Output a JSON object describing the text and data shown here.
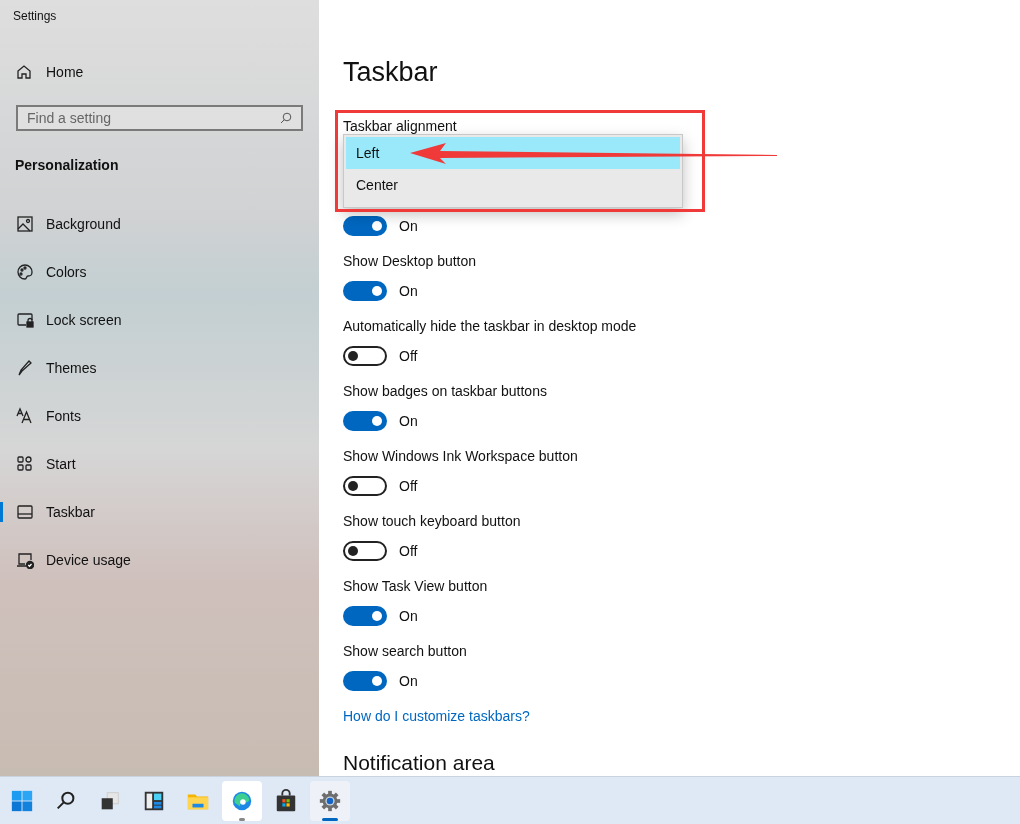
{
  "window": {
    "title": "Settings"
  },
  "sidebar": {
    "home": "Home",
    "search": {
      "placeholder": "Find a setting"
    },
    "section": "Personalization",
    "items": [
      {
        "label": "Background",
        "selected": false
      },
      {
        "label": "Colors",
        "selected": false
      },
      {
        "label": "Lock screen",
        "selected": false
      },
      {
        "label": "Themes",
        "selected": false
      },
      {
        "label": "Fonts",
        "selected": false
      },
      {
        "label": "Start",
        "selected": false
      },
      {
        "label": "Taskbar",
        "selected": true
      },
      {
        "label": "Device usage",
        "selected": false
      }
    ]
  },
  "main": {
    "title": "Taskbar",
    "alignment": {
      "label": "Taskbar alignment",
      "options": [
        {
          "label": "Left",
          "selected": true
        },
        {
          "label": "Center",
          "selected": false
        }
      ]
    },
    "settings": [
      {
        "on": true,
        "state": "On"
      },
      {
        "label": "Show Desktop button",
        "on": true,
        "state": "On"
      },
      {
        "label": "Automatically hide the taskbar in desktop mode",
        "on": false,
        "state": "Off"
      },
      {
        "label": "Show badges on taskbar buttons",
        "on": true,
        "state": "On"
      },
      {
        "label": "Show Windows Ink Workspace button",
        "on": false,
        "state": "Off"
      },
      {
        "label": "Show touch keyboard button",
        "on": false,
        "state": "Off"
      },
      {
        "label": "Show Task View button",
        "on": true,
        "state": "On"
      },
      {
        "label": "Show search button",
        "on": true,
        "state": "On"
      }
    ],
    "link": "How do I customize taskbars?",
    "next_section": "Notification area"
  },
  "taskbar": {
    "apps": [
      {
        "running": false,
        "active": false
      },
      {
        "running": false,
        "active": false
      },
      {
        "running": false,
        "active": false
      },
      {
        "running": false,
        "active": false
      },
      {
        "running": false,
        "active": false
      },
      {
        "running": true,
        "active": false
      },
      {
        "running": false,
        "active": false
      },
      {
        "running": true,
        "active": true
      }
    ]
  }
}
